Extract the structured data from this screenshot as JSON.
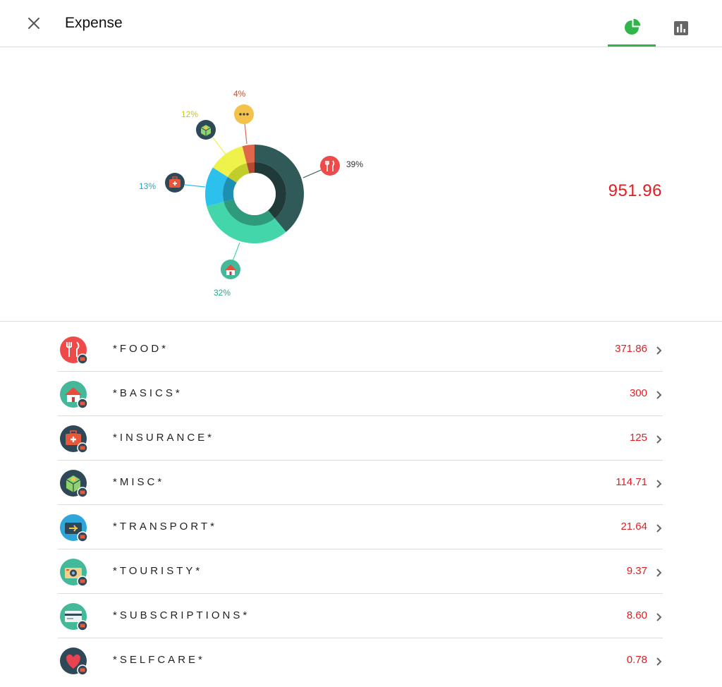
{
  "header": {
    "title": "Expense",
    "close_icon": "close-icon",
    "tabs": [
      {
        "name": "pie-chart-tab",
        "icon": "pie-chart-icon",
        "active": true
      },
      {
        "name": "bar-chart-tab",
        "icon": "bar-chart-icon",
        "active": false
      }
    ],
    "accent": "#2fb54a"
  },
  "total": "951.96",
  "chart_data": {
    "type": "pie",
    "style": "donut",
    "slices": [
      {
        "label": "39%",
        "value": 39,
        "icon": "food-icon",
        "color": "#2f5a57",
        "inner": "#1f3a38",
        "label_color": "#333333"
      },
      {
        "label": "32%",
        "value": 32,
        "icon": "basics-icon",
        "color": "#43d6ab",
        "inner": "#2e9b7d",
        "label_color": "#2aa68a"
      },
      {
        "label": "13%",
        "value": 13,
        "icon": "insurance-icon",
        "color": "#2cc0ec",
        "inner": "#1c8fb3",
        "label_color": "#2aa0c8"
      },
      {
        "label": "12%",
        "value": 12,
        "icon": "misc-icon",
        "color": "#eef24a",
        "inner": "#c2cc2a",
        "label_color": "#c8c420"
      },
      {
        "label": "4%",
        "value": 4,
        "icon": "other-icon",
        "color": "#e1674a",
        "inner": "#b04a32",
        "label_color": "#c8502e"
      }
    ]
  },
  "categories": [
    {
      "name": "*FOOD*",
      "value": "371.86",
      "icon": "food-icon"
    },
    {
      "name": "*BASICS*",
      "value": "300",
      "icon": "basics-icon"
    },
    {
      "name": "*INSURANCE*",
      "value": "125",
      "icon": "insurance-icon"
    },
    {
      "name": "*MISC*",
      "value": "114.71",
      "icon": "misc-icon"
    },
    {
      "name": "*TRANSPORT*",
      "value": "21.64",
      "icon": "transport-icon"
    },
    {
      "name": "*TOURISTY*",
      "value": "9.37",
      "icon": "touristy-icon"
    },
    {
      "name": "*SUBSCRIPTIONS*",
      "value": "8.60",
      "icon": "subscriptions-icon"
    },
    {
      "name": "*SELFCARE*",
      "value": "0.78",
      "icon": "selfcare-icon"
    }
  ],
  "colors": {
    "value_red": "#e01e22",
    "divider": "#dcdcdc"
  }
}
